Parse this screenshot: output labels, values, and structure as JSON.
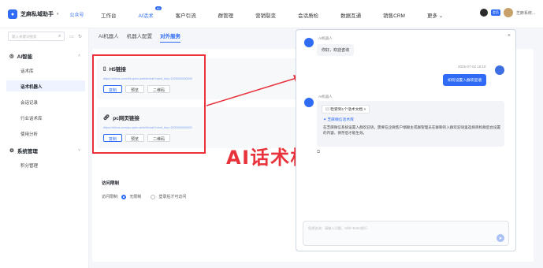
{
  "brand": {
    "name": "芝麻私域助手",
    "link": "公众号"
  },
  "nav": {
    "items": [
      "工作台",
      "AI话术",
      "客户引流",
      "群管理",
      "营销裂变",
      "会话质检",
      "数据互通",
      "销售CRM",
      "更多"
    ],
    "badge": "AI",
    "more_caret": "⌄"
  },
  "user": {
    "tag": "会员",
    "name": "芝麻系统..."
  },
  "sidebar": {
    "search_placeholder": "输入关键词搜索",
    "groups": [
      {
        "label": "AI智能",
        "items": [
          "话术库",
          "话术机器人",
          "会话记录",
          "行业话术库",
          "使用分析"
        ]
      },
      {
        "label": "系统管理",
        "items": [
          "积分管理"
        ]
      }
    ],
    "active_item": "话术机器人"
  },
  "tabs": [
    "AI机器人",
    "机器人配置",
    "对外服务"
  ],
  "cards": [
    {
      "title": "H5链接",
      "url": "https://zhima.com/h5-open-web/#/chat?robot_key=1000000000000",
      "buttons": [
        "复制",
        "预览",
        "二维码"
      ]
    },
    {
      "title": "pc网页链接",
      "url": "https://zhima.com/pc-open-web/#/chat?robot_key=1000000000000",
      "buttons": [
        "复制",
        "预览",
        "二维码"
      ]
    }
  ],
  "access": {
    "title": "访问限制",
    "label": "访问限制:",
    "options": [
      "无限制",
      "登录后才可访问"
    ],
    "selected": "无限制"
  },
  "annotation": "AI话术机器人对外服务",
  "chat": {
    "bot_name": "AI机器人",
    "greeting": "你好，欢迎咨询",
    "time": "2025-07-02 15:18",
    "user_message": "如何设置入群欢迎语",
    "retrieve_chip": "检索到1个话术文档",
    "answer_head": "芝麻微信话术库",
    "answer_text": "在芝麻微信系统设置入群欢迎语，需要在企微客户端群主或群管理员在群聊的入群欢迎语里选择目标群后台设置的内容，保存后才能生效。",
    "input_placeholder": "您想咨询：请输入问题，Shift+Enter换行"
  }
}
